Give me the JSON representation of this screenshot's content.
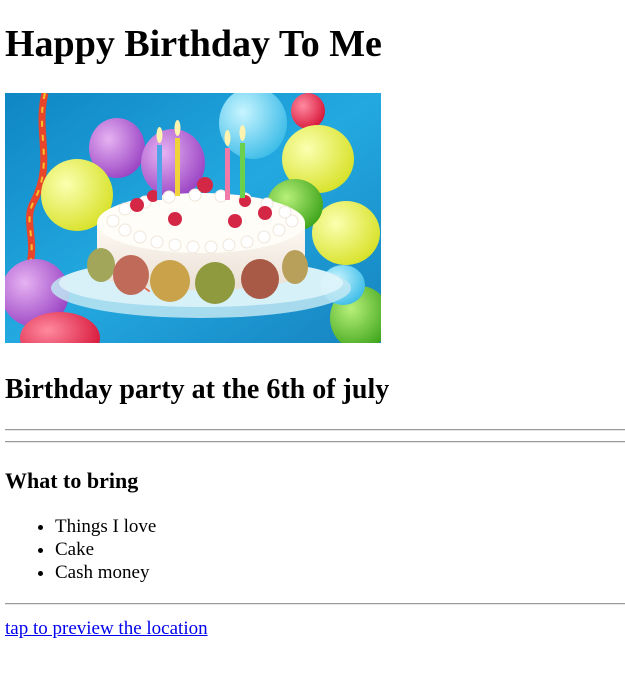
{
  "page": {
    "title": "Happy Birthday To Me",
    "image": {
      "icon": "birthday-cake-image",
      "colors": {
        "background": "#1d9ed6",
        "cake_cream": "#fbf6ef",
        "raspberry": "#d42745",
        "plate": "#bfe6f2"
      }
    },
    "subtitle": "Birthday party at the 6th of july",
    "bring_heading": "What to bring",
    "bring_items": [
      "Things I love",
      "Cake",
      "Cash money"
    ],
    "location_link": "tap to preview the location",
    "colors": {
      "link": "#0000ee",
      "rule": "#9a9a9a",
      "text": "#000000"
    }
  }
}
